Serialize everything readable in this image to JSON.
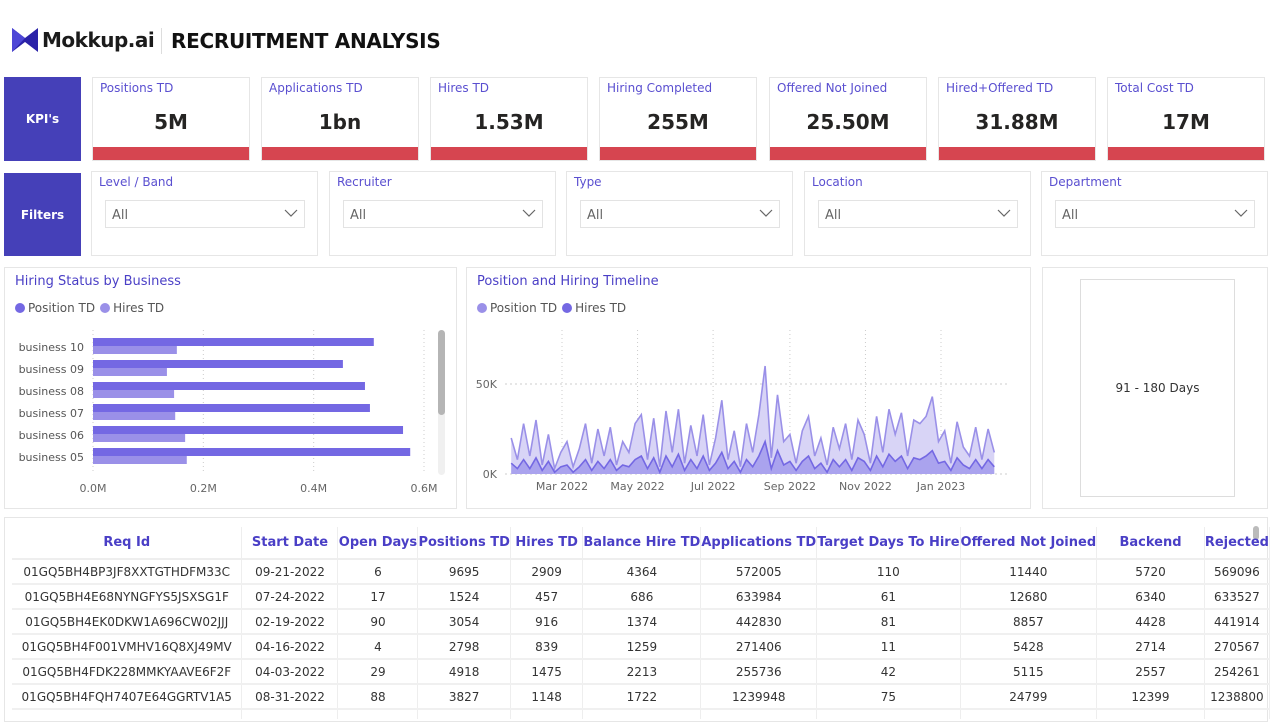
{
  "header": {
    "brand": "Mokkup.ai",
    "title": "RECRUITMENT ANALYSIS"
  },
  "kpis": {
    "label": "KPI's",
    "items": [
      {
        "label": "Positions TD",
        "value": "5M"
      },
      {
        "label": "Applications TD",
        "value": "1bn"
      },
      {
        "label": "Hires TD",
        "value": "1.53M"
      },
      {
        "label": "Hiring Completed",
        "value": "255M"
      },
      {
        "label": "Offered Not Joined",
        "value": "25.50M"
      },
      {
        "label": "Hired+Offered TD",
        "value": "31.88M"
      },
      {
        "label": "Total Cost TD",
        "value": "17M"
      }
    ]
  },
  "filters": {
    "label": "Filters",
    "items": [
      {
        "label": "Level / Band",
        "value": "All"
      },
      {
        "label": "Recruiter",
        "value": "All"
      },
      {
        "label": "Type",
        "value": "All"
      },
      {
        "label": "Location",
        "value": "All"
      },
      {
        "label": "Department",
        "value": "All"
      }
    ]
  },
  "colors": {
    "primary": "#4540b8",
    "kpi_bar": "#d64550",
    "series_dark": "#7468e3",
    "series_light": "#9a90e8"
  },
  "chart_data": [
    {
      "type": "bar",
      "orientation": "horizontal",
      "title": "Hiring Status by Business",
      "categories": [
        "business 10",
        "business 09",
        "business 08",
        "business 07",
        "business 06",
        "business 05"
      ],
      "series": [
        {
          "name": "Position TD",
          "values": [
            0.509,
            0.453,
            0.493,
            0.502,
            0.562,
            0.575
          ]
        },
        {
          "name": "Hires TD",
          "values": [
            0.152,
            0.134,
            0.147,
            0.149,
            0.167,
            0.17
          ]
        }
      ],
      "xlim": [
        0,
        0.6
      ],
      "xticks": [
        "0.0M",
        "0.2M",
        "0.4M",
        "0.6M"
      ],
      "grid": true,
      "legend": "top-left"
    },
    {
      "type": "area",
      "title": "Position and Hiring Timeline",
      "series_names": [
        "Position TD",
        "Hires TD"
      ],
      "points": [
        [
          "2022-01-19",
          20000,
          6000
        ],
        [
          "2022-01-24",
          8000,
          3000
        ],
        [
          "2022-01-29",
          28000,
          8000
        ],
        [
          "2022-02-03",
          10000,
          3000
        ],
        [
          "2022-02-08",
          30000,
          9000
        ],
        [
          "2022-02-13",
          5000,
          2000
        ],
        [
          "2022-02-18",
          22000,
          7000
        ],
        [
          "2022-02-23",
          3000,
          1000
        ],
        [
          "2022-02-28",
          12000,
          4000
        ],
        [
          "2022-03-05",
          18000,
          5000
        ],
        [
          "2022-03-10",
          4000,
          1000
        ],
        [
          "2022-03-15",
          14000,
          4000
        ],
        [
          "2022-03-20",
          28000,
          8000
        ],
        [
          "2022-03-25",
          6000,
          2000
        ],
        [
          "2022-03-30",
          25000,
          7000
        ],
        [
          "2022-04-04",
          10000,
          3000
        ],
        [
          "2022-04-09",
          26000,
          8000
        ],
        [
          "2022-04-14",
          5000,
          2000
        ],
        [
          "2022-04-19",
          18000,
          5000
        ],
        [
          "2022-04-24",
          12000,
          4000
        ],
        [
          "2022-04-29",
          28000,
          8000
        ],
        [
          "2022-05-04",
          33000,
          10000
        ],
        [
          "2022-05-09",
          8000,
          3000
        ],
        [
          "2022-05-14",
          31000,
          9000
        ],
        [
          "2022-05-19",
          4000,
          1000
        ],
        [
          "2022-05-24",
          35000,
          10000
        ],
        [
          "2022-05-29",
          12000,
          4000
        ],
        [
          "2022-06-03",
          36000,
          11000
        ],
        [
          "2022-06-08",
          6000,
          2000
        ],
        [
          "2022-06-13",
          27000,
          8000
        ],
        [
          "2022-06-18",
          10000,
          3000
        ],
        [
          "2022-06-23",
          33000,
          10000
        ],
        [
          "2022-06-28",
          5000,
          2000
        ],
        [
          "2022-07-03",
          20000,
          6000
        ],
        [
          "2022-07-08",
          41000,
          12000
        ],
        [
          "2022-07-13",
          8000,
          3000
        ],
        [
          "2022-07-18",
          24000,
          7000
        ],
        [
          "2022-07-23",
          4000,
          1000
        ],
        [
          "2022-07-28",
          28000,
          8000
        ],
        [
          "2022-08-02",
          12000,
          4000
        ],
        [
          "2022-08-07",
          33000,
          10000
        ],
        [
          "2022-08-12",
          60000,
          18000
        ],
        [
          "2022-08-17",
          9000,
          3000
        ],
        [
          "2022-08-22",
          44000,
          13000
        ],
        [
          "2022-08-27",
          18000,
          5000
        ],
        [
          "2022-09-01",
          22000,
          7000
        ],
        [
          "2022-09-06",
          6000,
          2000
        ],
        [
          "2022-09-11",
          24000,
          7000
        ],
        [
          "2022-09-16",
          32000,
          10000
        ],
        [
          "2022-09-21",
          10000,
          3000
        ],
        [
          "2022-09-26",
          20000,
          6000
        ],
        [
          "2022-10-01",
          5000,
          1000
        ],
        [
          "2022-10-06",
          26000,
          8000
        ],
        [
          "2022-10-11",
          14000,
          4000
        ],
        [
          "2022-10-16",
          28000,
          8000
        ],
        [
          "2022-10-21",
          8000,
          2000
        ],
        [
          "2022-10-26",
          30000,
          9000
        ],
        [
          "2022-10-31",
          22000,
          7000
        ],
        [
          "2022-11-05",
          6000,
          2000
        ],
        [
          "2022-11-10",
          32000,
          10000
        ],
        [
          "2022-11-15",
          12000,
          4000
        ],
        [
          "2022-11-20",
          36000,
          11000
        ],
        [
          "2022-11-25",
          22000,
          7000
        ],
        [
          "2022-11-30",
          34000,
          10000
        ],
        [
          "2022-12-05",
          10000,
          3000
        ],
        [
          "2022-12-10",
          30000,
          9000
        ],
        [
          "2022-12-15",
          28000,
          8000
        ],
        [
          "2022-12-20",
          32000,
          10000
        ],
        [
          "2022-12-25",
          43000,
          13000
        ],
        [
          "2022-12-30",
          18000,
          6000
        ],
        [
          "2023-01-04",
          24000,
          7000
        ],
        [
          "2023-01-09",
          6000,
          2000
        ],
        [
          "2023-01-14",
          29000,
          9000
        ],
        [
          "2023-01-19",
          15000,
          5000
        ],
        [
          "2023-01-24",
          10000,
          3000
        ],
        [
          "2023-01-29",
          26000,
          8000
        ],
        [
          "2023-02-03",
          8000,
          3000
        ],
        [
          "2023-02-08",
          25000,
          8000
        ],
        [
          "2023-02-13",
          12000,
          4000
        ]
      ],
      "ylim": [
        0,
        50000
      ],
      "yticks": [
        "0K",
        "50K"
      ],
      "xticks": [
        "Mar 2022",
        "May 2022",
        "Jul 2022",
        "Sep 2022",
        "Nov 2022",
        "Jan 2023"
      ],
      "grid": true,
      "legend": "top-left"
    }
  ],
  "days_card": {
    "label": "91 - 180 Days"
  },
  "table": {
    "columns": [
      "Req Id",
      "Start Date",
      "Open Days",
      "Positions TD",
      "Hires TD",
      "Balance Hire TD",
      "Applications TD",
      "Target Days To Hire",
      "Offered Not Joined",
      "Backend",
      "Rejected"
    ],
    "rows": [
      [
        "01GQ5BH4BP3JF8XXTGTHDFM33C",
        "09-21-2022",
        "6",
        "9695",
        "2909",
        "4364",
        "572005",
        "110",
        "11440",
        "5720",
        "569096"
      ],
      [
        "01GQ5BH4E68NYNGFYS5JSXSG1F",
        "07-24-2022",
        "17",
        "1524",
        "457",
        "686",
        "633984",
        "61",
        "12680",
        "6340",
        "633527"
      ],
      [
        "01GQ5BH4EK0DKW1A696CW02JJJ",
        "02-19-2022",
        "90",
        "3054",
        "916",
        "1374",
        "442830",
        "81",
        "8857",
        "4428",
        "441914"
      ],
      [
        "01GQ5BH4F001VMHV16Q8XJ49MV",
        "04-16-2022",
        "4",
        "2798",
        "839",
        "1259",
        "271406",
        "11",
        "5428",
        "2714",
        "270567"
      ],
      [
        "01GQ5BH4FDK228MMKYAAVE6F2F",
        "04-03-2022",
        "29",
        "4918",
        "1475",
        "2213",
        "255736",
        "42",
        "5115",
        "2557",
        "254261"
      ],
      [
        "01GQ5BH4FQH7407E64GGRTV1A5",
        "08-31-2022",
        "88",
        "3827",
        "1148",
        "1722",
        "1239948",
        "75",
        "24799",
        "12399",
        "1238800"
      ]
    ]
  }
}
